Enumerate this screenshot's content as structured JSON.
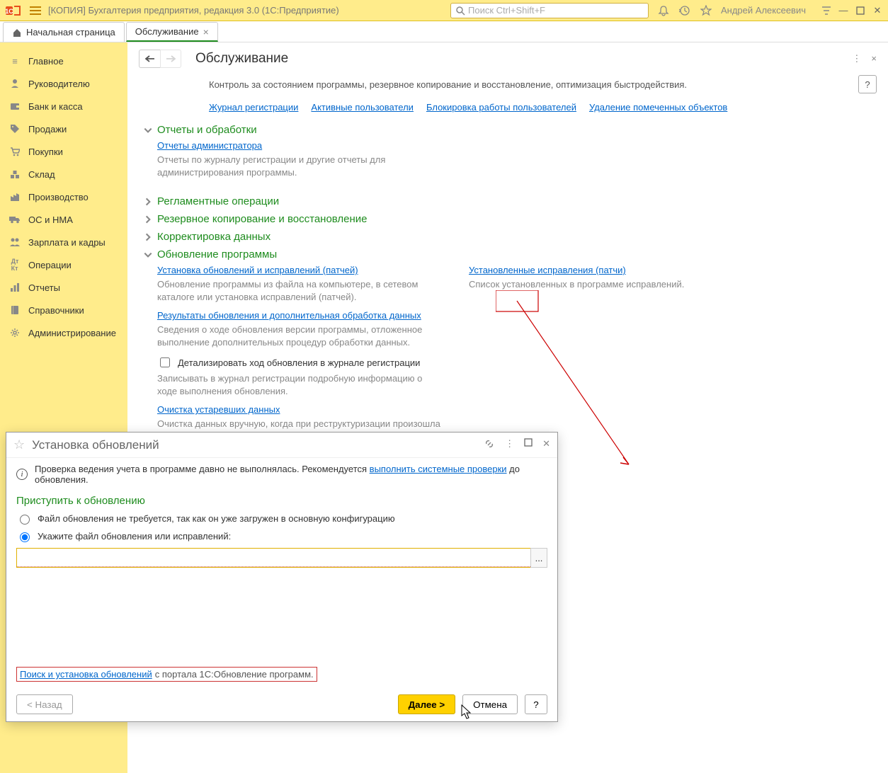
{
  "app_title": "[КОПИЯ] Бухгалтерия предприятия, редакция 3.0  (1С:Предприятие)",
  "search_placeholder": "Поиск Ctrl+Shift+F",
  "user_name": "Андрей Алексеевич",
  "tabs": {
    "home": "Начальная страница",
    "maintenance": "Обслуживание"
  },
  "sidebar": {
    "items": [
      {
        "label": "Главное"
      },
      {
        "label": "Руководителю"
      },
      {
        "label": "Банк и касса"
      },
      {
        "label": "Продажи"
      },
      {
        "label": "Покупки"
      },
      {
        "label": "Склад"
      },
      {
        "label": "Производство"
      },
      {
        "label": "ОС и НМА"
      },
      {
        "label": "Зарплата и кадры"
      },
      {
        "label": "Операции"
      },
      {
        "label": "Отчеты"
      },
      {
        "label": "Справочники"
      },
      {
        "label": "Администрирование"
      }
    ]
  },
  "content": {
    "page_title": "Обслуживание",
    "description": "Контроль за состоянием программы, резервное копирование и восстановление, оптимизация быстродействия.",
    "help_label": "?",
    "top_links": [
      "Журнал регистрации",
      "Активные пользователи",
      "Блокировка работы пользователей",
      "Удаление помеченных объектов"
    ]
  },
  "sections": {
    "reports": {
      "title": "Отчеты и обработки",
      "link": "Отчеты администратора",
      "desc": "Отчеты по журналу регистрации и другие отчеты для администрирования программы."
    },
    "routine": {
      "title": "Регламентные операции"
    },
    "backup": {
      "title": "Резервное копирование и восстановление"
    },
    "correct": {
      "title": "Корректировка данных"
    },
    "update": {
      "title": "Обновление программы",
      "install_link": "Установка обновлений и исправлений (патчей)",
      "install_desc": "Обновление программы из файла на компьютере, в сетевом каталоге или установка исправлений (патчей).",
      "installed_link": "Установленные исправления (патчи)",
      "installed_desc": "Список установленных в программе исправлений.",
      "results_link": "Результаты обновления и дополнительная обработка данных",
      "results_desc": "Сведения о ходе обновления версии программы, отложенное выполнение дополнительных процедур обработки данных.",
      "detail_chk": "Детализировать ход обновления в журнале регистрации",
      "detail_desc": "Записывать в журнал регистрации подробную информацию о ходе выполнения обновления.",
      "cleanup_link": "Очистка устаревших данных",
      "cleanup_desc": "Очистка данных вручную, когда при реструктуризации произошла ошибка «Записи регистра стали неуникальными»"
    }
  },
  "dialog": {
    "title": "Установка обновлений",
    "info_prefix": "Проверка ведения учета в программе давно не выполнялась. Рекомендуется ",
    "info_link": "выполнить системные проверки",
    "info_suffix": " до обновления.",
    "green_title": "Приступить к обновлению",
    "radio1": "Файл обновления не требуется, так как он уже загружен в основную конфигурацию",
    "radio2": "Укажите файл обновления или исправлений:",
    "portal_link": "Поиск и установка обновлений",
    "portal_suffix": " с портала 1С:Обновление программ.",
    "back_btn": "< Назад",
    "next_btn": "Далее >",
    "cancel_btn": "Отмена",
    "help_btn": "?",
    "browse_btn": "..."
  }
}
